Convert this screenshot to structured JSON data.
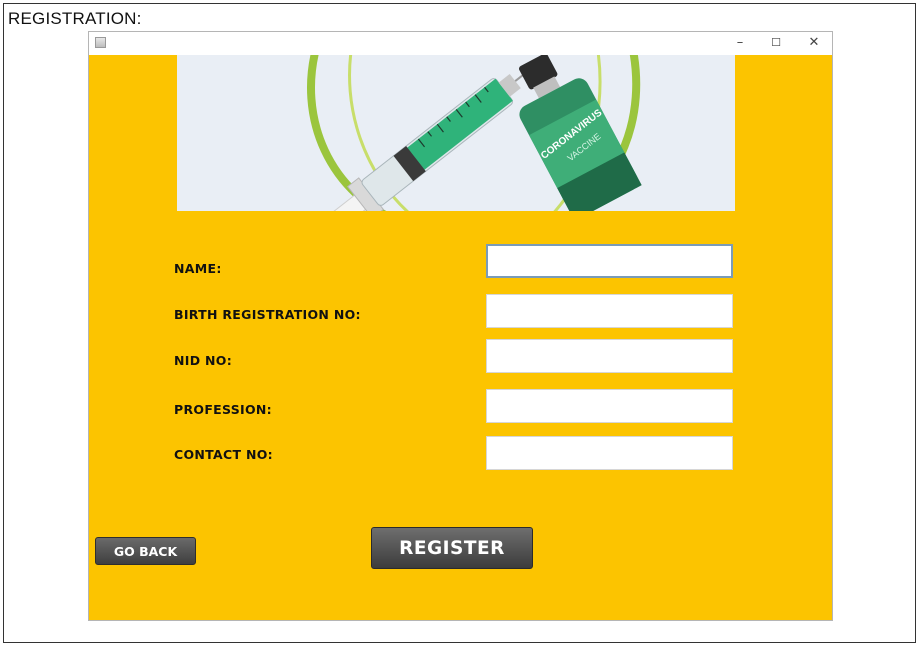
{
  "outer": {
    "title": "REGISTRATION:"
  },
  "window": {
    "minimize": "–",
    "maximize": "☐",
    "close": "✕"
  },
  "banner": {
    "vial_text_1": "CORONAVIRUS",
    "vial_text_2": "VACCINE"
  },
  "form": {
    "name_label": "NAME:",
    "birth_reg_label": "BIRTH REGISTRATION NO:",
    "nid_label": "NID NO:",
    "profession_label": "PROFESSION:",
    "contact_label": "CONTACT NO:",
    "name_value": "",
    "birth_reg_value": "",
    "nid_value": "",
    "profession_value": "",
    "contact_value": ""
  },
  "buttons": {
    "go_back": "GO BACK",
    "register": "REGISTER"
  },
  "colors": {
    "background": "#fcc400",
    "button": "#4a4a4a",
    "banner": "#e9eef5"
  }
}
